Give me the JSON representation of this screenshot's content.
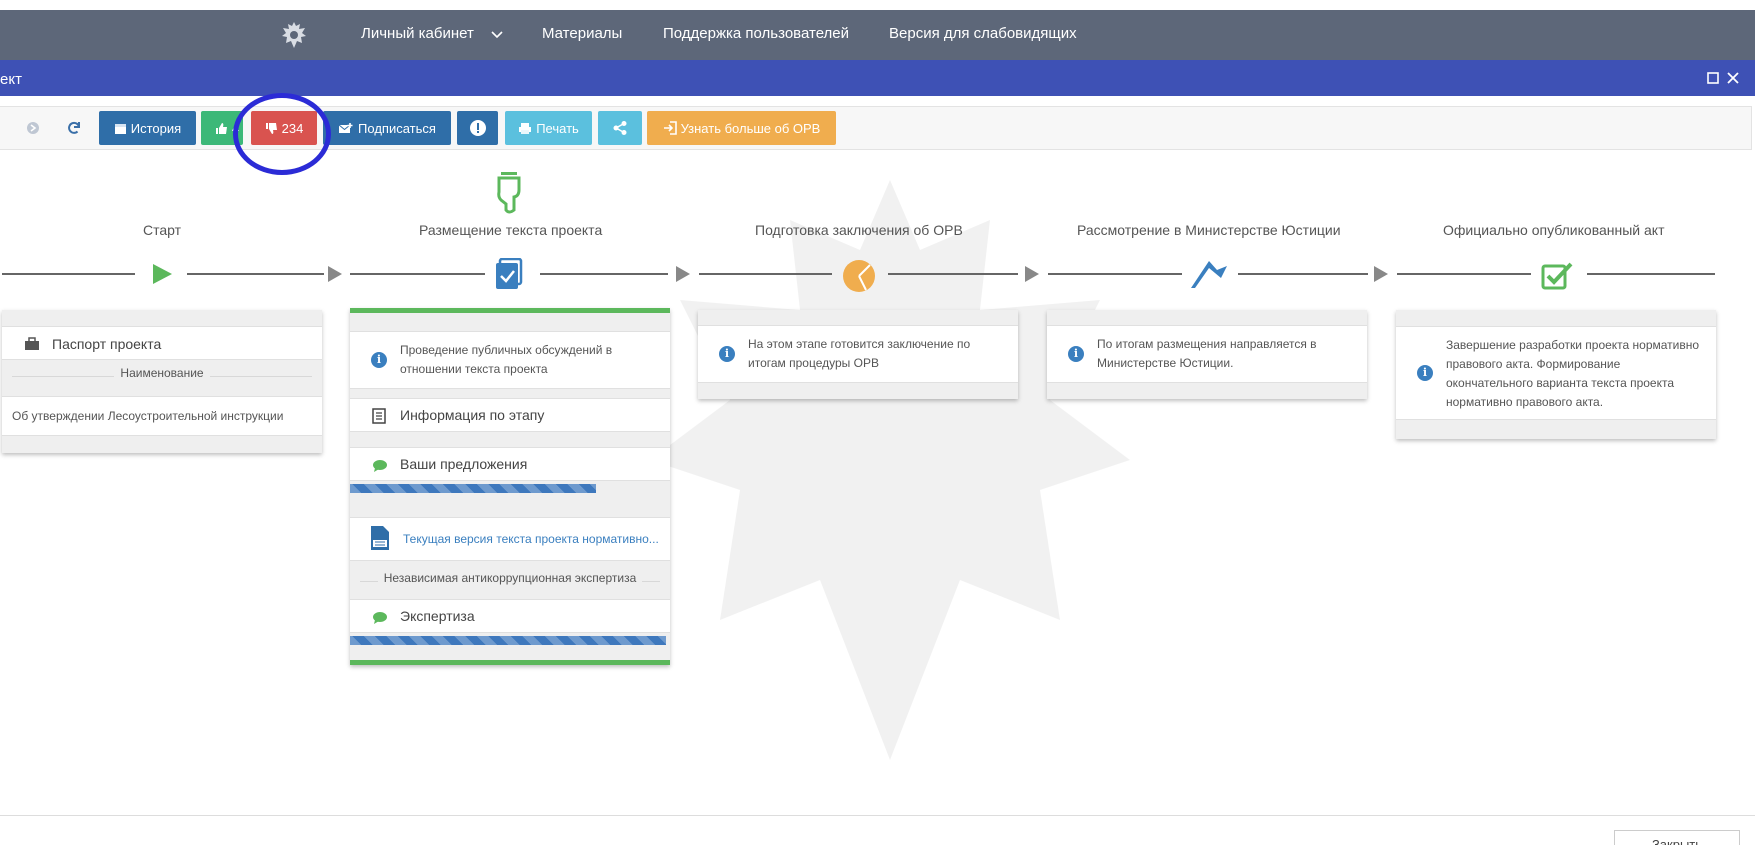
{
  "nav": {
    "items": [
      "Личный кабинет",
      "Материалы",
      "Поддержка пользователей",
      "Версия для слабовидящих"
    ]
  },
  "window": {
    "title": "ект"
  },
  "toolbar": {
    "history_label": "История",
    "likes_label": "4",
    "dislikes_label": "234",
    "subscribe_label": "Подписаться",
    "print_label": "Печать",
    "learn_more_label": "Узнать больше об ОРВ"
  },
  "steps": [
    {
      "title": "Старт",
      "icon": "play-icon",
      "color": "#5cb85c"
    },
    {
      "title": "Размещение текста проекта",
      "icon": "checklist-icon",
      "color": "#3a7fbf"
    },
    {
      "title": "Подготовка заключения об ОРВ",
      "icon": "pie-icon",
      "color": "#f0ad4e"
    },
    {
      "title": "Рассмотрение в Министерстве Юстиции",
      "icon": "flag-icon",
      "color": "#3a7fbf"
    },
    {
      "title": "Официально опубликованный акт",
      "icon": "check-square-icon",
      "color": "#5cb85c"
    }
  ],
  "start_card": {
    "passport_label": "Паспорт проекта",
    "name_header": "Наименование",
    "name_value": "Об утверждении Лесоустроительной инструкции"
  },
  "stage_card": {
    "info_text": "Проведение публичных обсуждений в отношении текста проекта",
    "stage_info_label": "Информация по этапу",
    "proposals_label": "Ваши предложения",
    "proposals_progress": 0.78,
    "doc_link": "Текущая версия текста проекта нормативно...",
    "expertise_header": "Независимая антикоррупционная экспертиза",
    "expertise_label": "Экспертиза",
    "expertise_progress": 1.0
  },
  "orv_card": {
    "info_text": "На этом этапе готовится заключение по итогам процедуры ОРВ"
  },
  "justice_card": {
    "info_text": "По итогам размещения направляется в Министерстве Юстиции."
  },
  "act_card": {
    "info_text": "Завершение разработки проекта нормативно правового акта. Формирование окончательного варианта текста проекта нормативно правового акта."
  },
  "footer": {
    "close_label": "Закрыть"
  },
  "colors": {
    "nav_bg": "#5d6779",
    "titlebar_bg": "#3e51b5",
    "history_btn": "#2f6ea8",
    "like_btn": "#3cb878",
    "dislike_btn": "#d9534f",
    "subscribe_btn": "#2f6ea8",
    "alert_btn": "#2f6ea8",
    "print_btn": "#5bc0de",
    "share_btn": "#5bc0de",
    "learn_btn": "#f0ad4e",
    "annotation": "#2b2bd6"
  }
}
